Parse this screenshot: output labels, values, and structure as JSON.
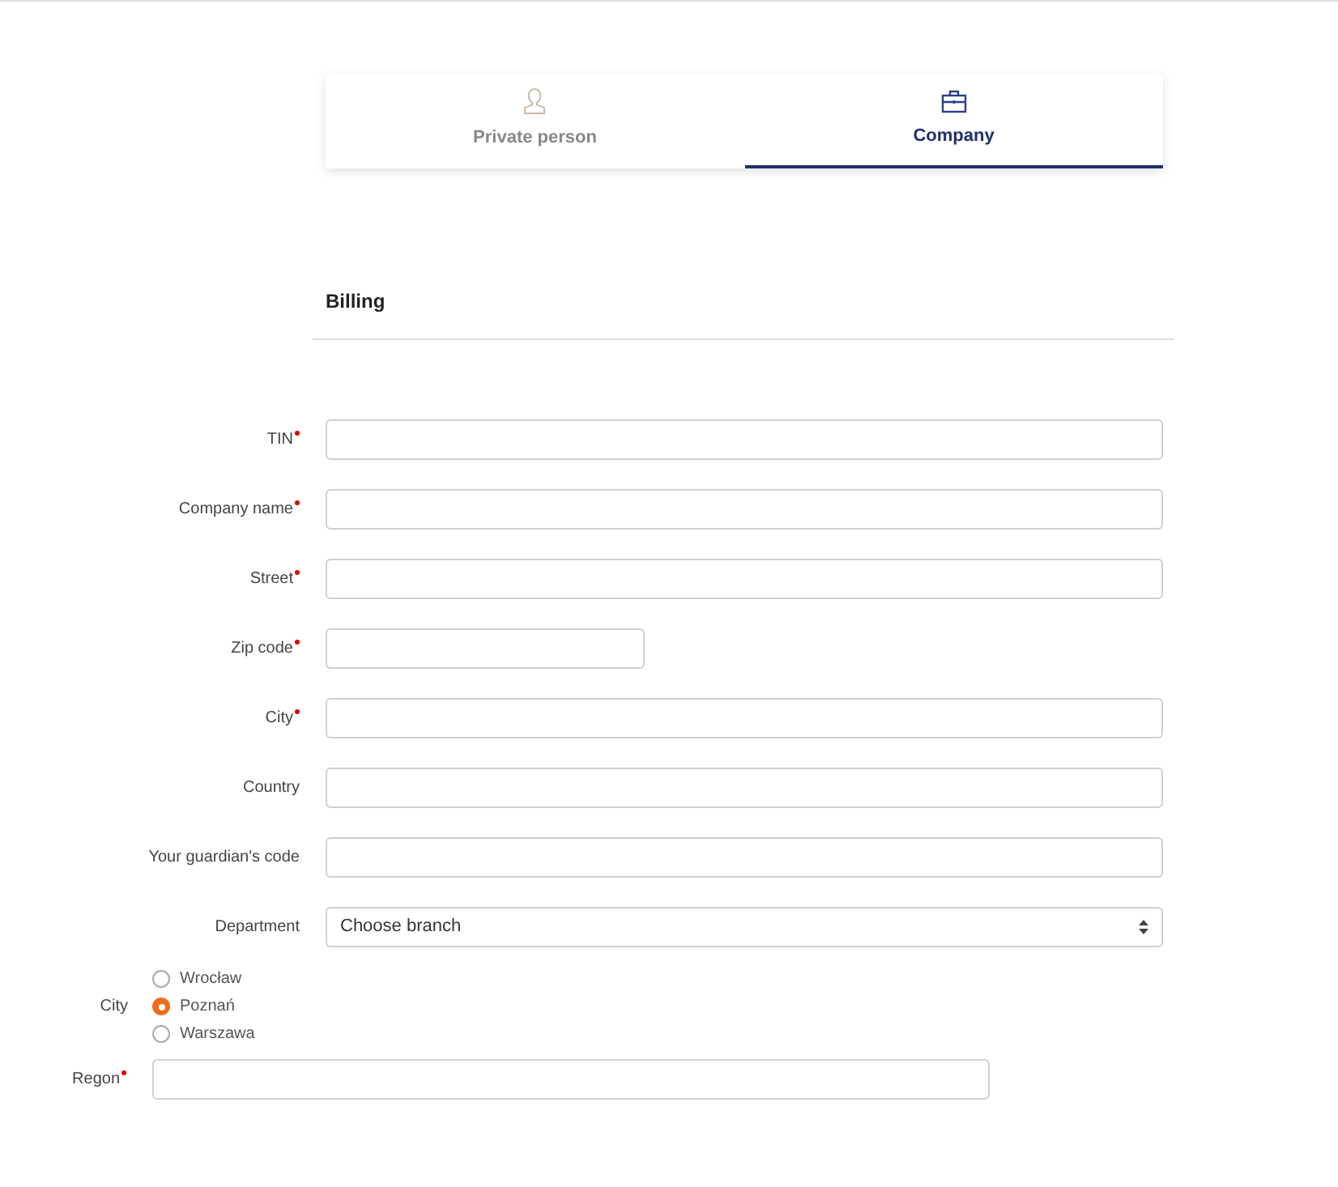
{
  "tabs": [
    {
      "label": "Private person",
      "kind": "person",
      "selected": false
    },
    {
      "label": "Company",
      "kind": "briefcase",
      "selected": true
    }
  ],
  "section_title": "Billing",
  "fields": [
    {
      "label": "TIN",
      "required": true,
      "kind": "text"
    },
    {
      "label": "Company name",
      "required": true,
      "kind": "text"
    },
    {
      "label": "Street",
      "required": true,
      "kind": "text"
    },
    {
      "label": "Zip code",
      "required": true,
      "kind": "short"
    },
    {
      "label": "City",
      "required": true,
      "kind": "text"
    },
    {
      "label": "Country",
      "required": false,
      "kind": "text"
    },
    {
      "label": "Your guardian's code",
      "required": false,
      "kind": "text"
    },
    {
      "label": "Department",
      "required": false,
      "kind": "select",
      "value": "Choose branch"
    }
  ],
  "city_group": {
    "label": "City",
    "options": [
      {
        "label": "Wrocław",
        "selected": false
      },
      {
        "label": "Poznań",
        "selected": true
      },
      {
        "label": "Warszawa",
        "selected": false
      }
    ]
  },
  "regon": {
    "label": "Regon",
    "required": true
  }
}
